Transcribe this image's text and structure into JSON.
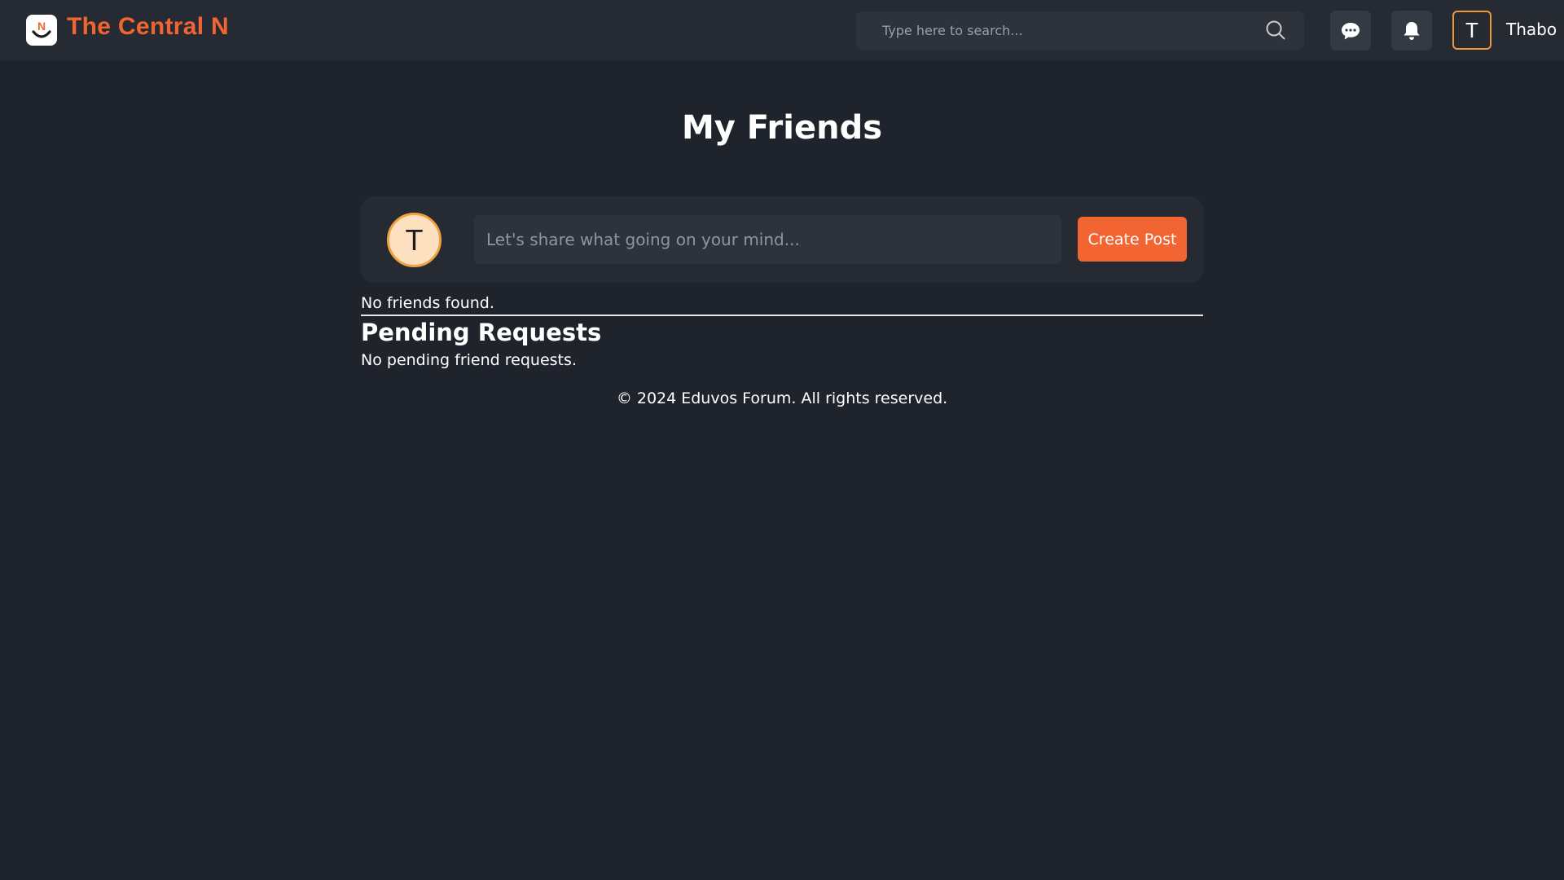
{
  "header": {
    "brand": "The Central N",
    "logo_letter": "N",
    "search": {
      "placeholder": "Type here to search..."
    },
    "icons": {
      "chat": "chat-bubble-icon",
      "notifications": "bell-icon",
      "search": "search-icon"
    },
    "user": {
      "avatar_initial": "T",
      "name": "Thabo"
    }
  },
  "main": {
    "title": "My Friends",
    "composer": {
      "avatar_initial": "T",
      "placeholder": "Let's share what going on your mind...",
      "button_label": "Create Post"
    },
    "friends_empty": "No friends found.",
    "pending": {
      "title": "Pending Requests",
      "empty": "No pending friend requests."
    }
  },
  "footer": {
    "text": "© 2024 Eduvos Forum. All rights reserved."
  },
  "colors": {
    "background": "#1f232b",
    "topbar": "#262b33",
    "accent": "#f26432",
    "avatar_border": "#f0953e"
  }
}
